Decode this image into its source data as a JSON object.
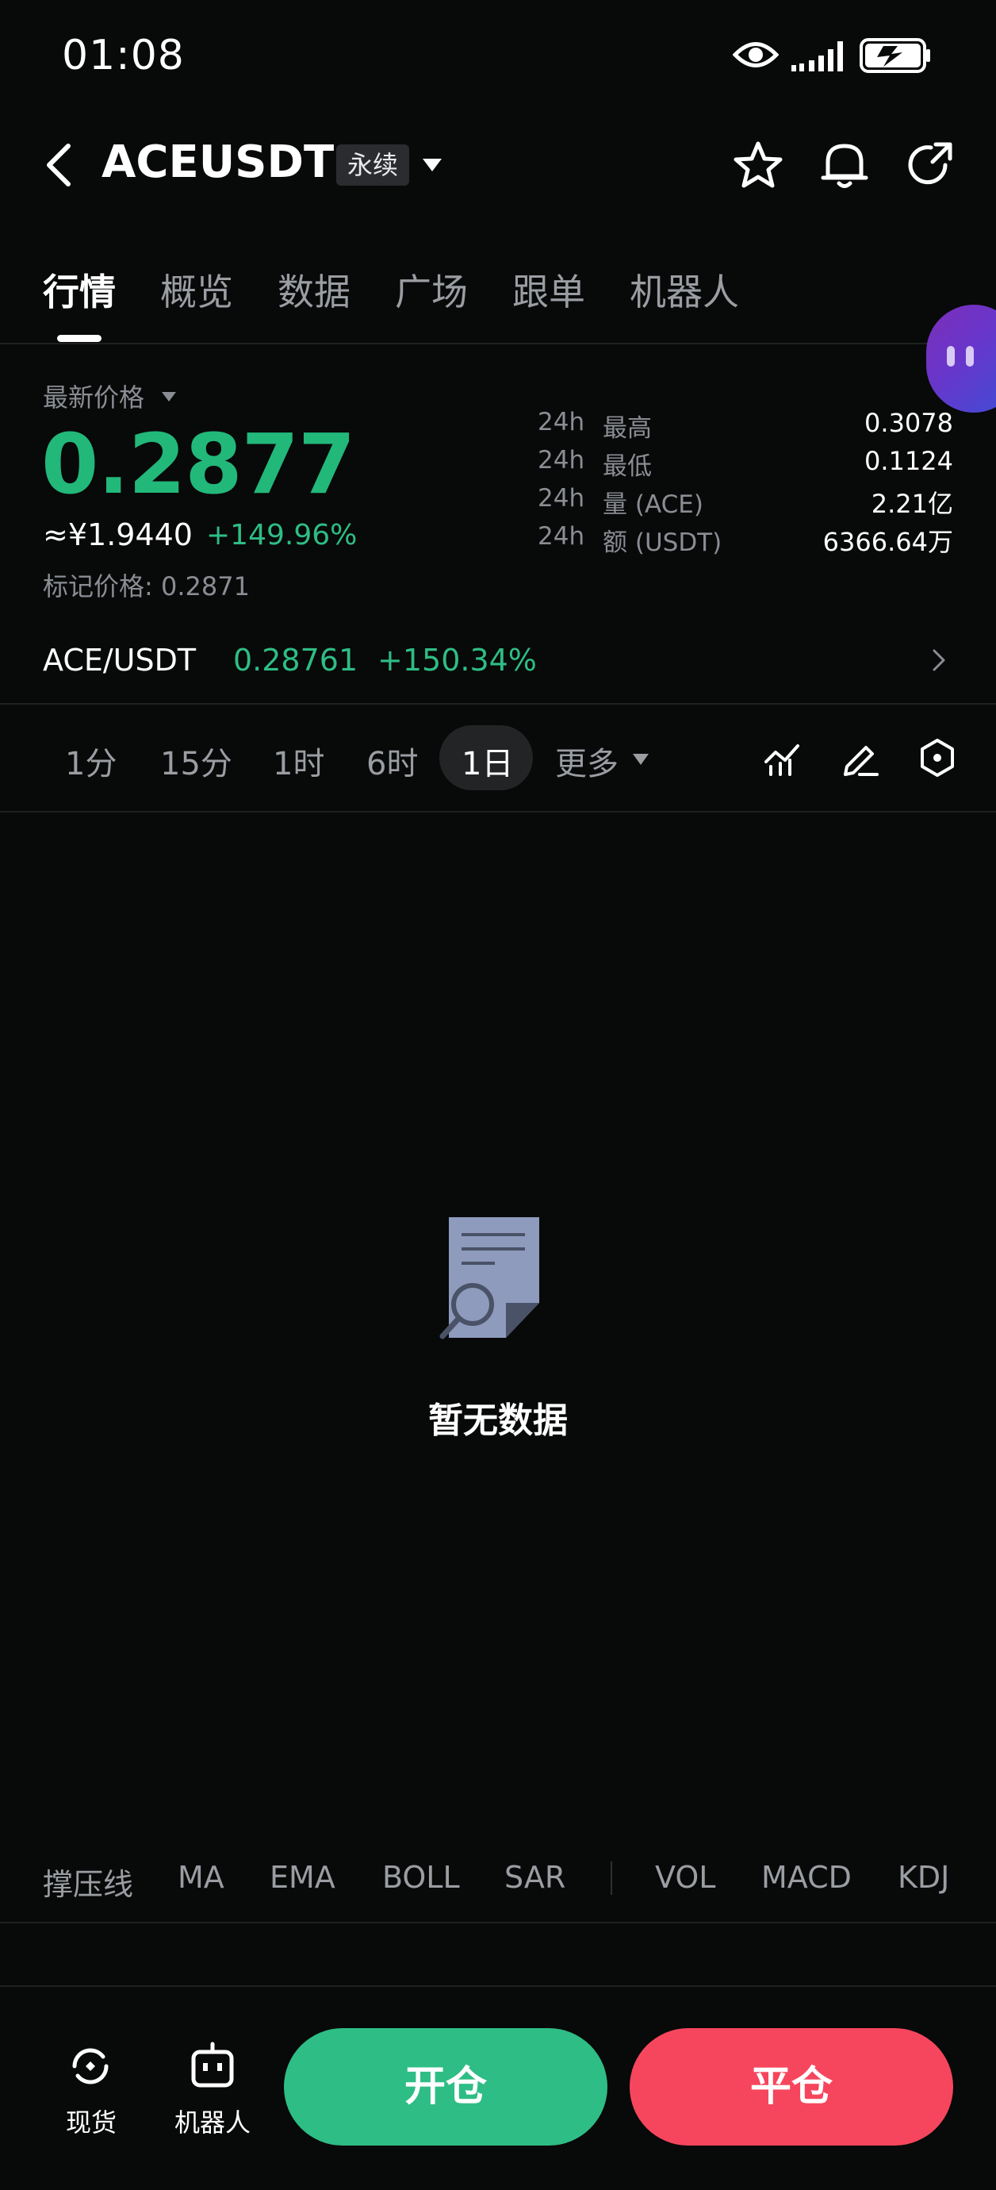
{
  "status_bar": {
    "time": "01:08"
  },
  "header": {
    "symbol": "ACEUSDT",
    "contract_type": "永续"
  },
  "tabs": [
    {
      "label": "行情"
    },
    {
      "label": "概览"
    },
    {
      "label": "数据"
    },
    {
      "label": "广场"
    },
    {
      "label": "跟单"
    },
    {
      "label": "机器人"
    }
  ],
  "price": {
    "latest_label": "最新价格",
    "last": "0.2877",
    "cny": "≈¥1.9440",
    "change": "+149.96%",
    "mark": "标记价格: 0.2871"
  },
  "stats": [
    {
      "period": "24h",
      "name": "最高",
      "value": "0.3078"
    },
    {
      "period": "24h",
      "name": "最低",
      "value": "0.1124"
    },
    {
      "period": "24h",
      "name": "量 (ACE)",
      "value": "2.21亿"
    },
    {
      "period": "24h",
      "name": "额 (USDT)",
      "value": "6366.64万"
    }
  ],
  "spot": {
    "pair": "ACE/USDT",
    "price": "0.28761",
    "change": "+150.34%"
  },
  "intervals": {
    "items": [
      "1分",
      "15分",
      "1时",
      "6时",
      "1日"
    ],
    "more": "更多",
    "selected": "1日"
  },
  "empty_state": {
    "text": "暂无数据"
  },
  "indicators": [
    "撑压线",
    "MA",
    "EMA",
    "BOLL",
    "SAR",
    "VOL",
    "MACD",
    "KDJ"
  ],
  "bottom_bar": {
    "spot_label": "现货",
    "robot_label": "机器人",
    "open_label": "开仓",
    "close_label": "平仓"
  },
  "colors": {
    "up": "#2ebd85",
    "down": "#f6465d",
    "background": "#080909"
  }
}
